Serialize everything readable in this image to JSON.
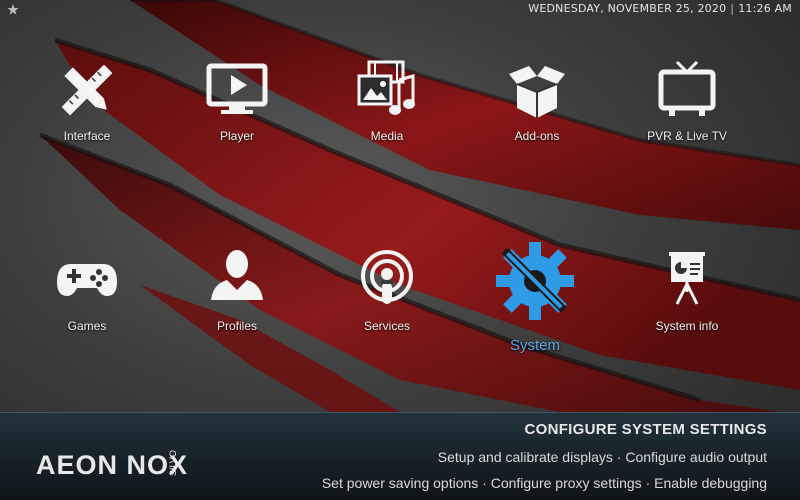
{
  "topbar": {
    "date": "WEDNESDAY, NOVEMBER 25, 2020",
    "separator": "|",
    "time": "11:26 AM"
  },
  "menu": {
    "interface": "Interface",
    "player": "Player",
    "media": "Media",
    "addons": "Add-ons",
    "pvr": "PVR & Live TV",
    "games": "Games",
    "profiles": "Profiles",
    "services": "Services",
    "system": "System",
    "sysinfo": "System info"
  },
  "footer": {
    "logo_text": "AEON NOX",
    "logo_sub": "SILVO",
    "title": "CONFIGURE SYSTEM SETTINGS",
    "line1": "Setup and calibrate displays · Configure audio output",
    "line2": "Set power saving options · Configure proxy settings · Enable debugging"
  },
  "colors": {
    "accent": "#2f9be6",
    "label_active": "#5aa7e6",
    "red": "#8e1414"
  }
}
